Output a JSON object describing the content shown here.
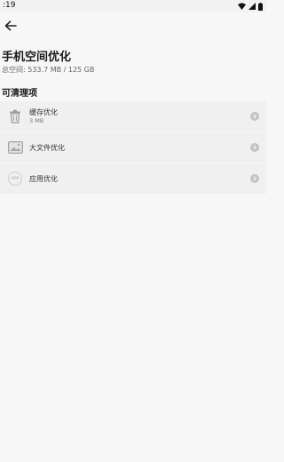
{
  "status_bar": {
    "time": ":19",
    "icons": [
      "wifi-icon",
      "signal-icon",
      "battery-icon"
    ]
  },
  "header": {
    "back_icon": "arrow-left-icon",
    "title": "手机空间优化",
    "storage_label": "总空间:",
    "storage_value": "533.7 MB / 125 GB"
  },
  "section": {
    "title": "可清理项"
  },
  "items": [
    {
      "icon": "trash-icon",
      "label": "缓存优化",
      "sub": "3 MB"
    },
    {
      "icon": "image-file-icon",
      "label": "大文件优化",
      "sub": ""
    },
    {
      "icon": "app-icon",
      "label": "应用优化",
      "sub": "",
      "badge_text": "APP"
    }
  ],
  "colors": {
    "background": "#f7f7f7",
    "card": "#f0f0f0",
    "chevron_bg": "#c4c4c4"
  }
}
